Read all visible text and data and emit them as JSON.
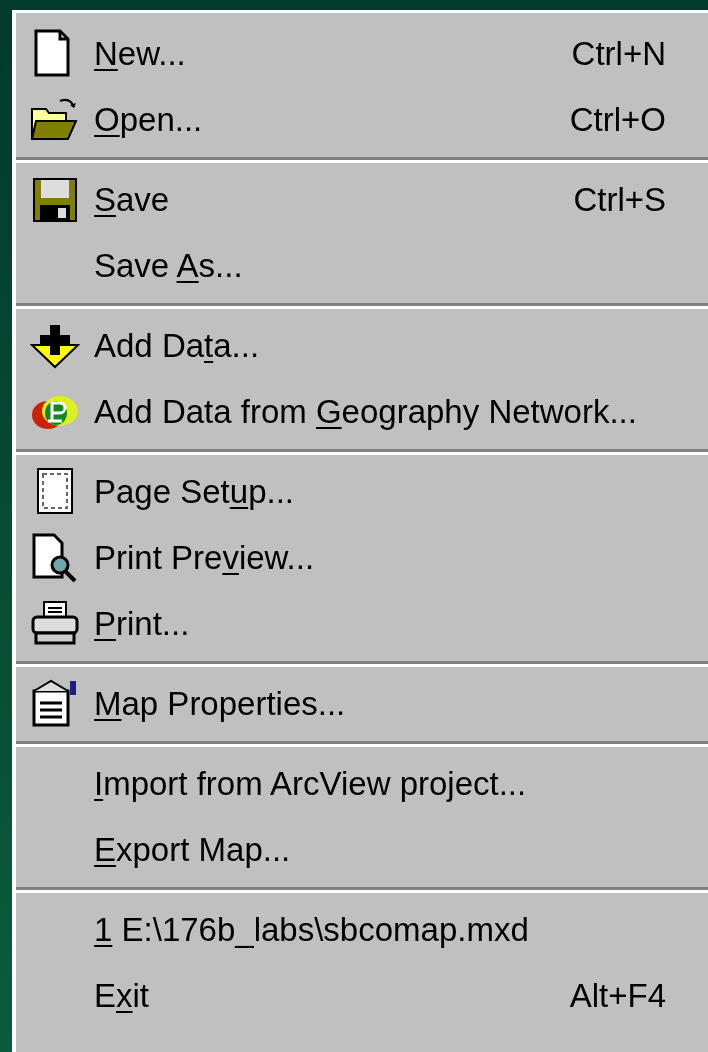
{
  "menu": {
    "items": [
      {
        "kind": "command",
        "key": "N",
        "after": "ew...",
        "shortcut": "Ctrl+N"
      },
      {
        "kind": "command",
        "key": "O",
        "after": "pen...",
        "shortcut": "Ctrl+O"
      },
      {
        "kind": "separator"
      },
      {
        "kind": "command",
        "key": "S",
        "after": "ave",
        "shortcut": "Ctrl+S"
      },
      {
        "kind": "command",
        "before": "Save ",
        "key": "A",
        "after": "s..."
      },
      {
        "kind": "separator"
      },
      {
        "kind": "command",
        "before": "Add Da",
        "key": "t",
        "after": "a..."
      },
      {
        "kind": "command",
        "before": "Add Data from ",
        "key": "G",
        "after": "eography Network..."
      },
      {
        "kind": "separator"
      },
      {
        "kind": "command",
        "before": "Page Set",
        "key": "u",
        "after": "p..."
      },
      {
        "kind": "command",
        "before": "Print Pre",
        "key": "v",
        "after": "iew..."
      },
      {
        "kind": "command",
        "key": "P",
        "after": "rint..."
      },
      {
        "kind": "separator"
      },
      {
        "kind": "command",
        "key": "M",
        "after": "ap Properties..."
      },
      {
        "kind": "separator"
      },
      {
        "kind": "command",
        "key": "I",
        "after": "mport from ArcView project..."
      },
      {
        "kind": "command",
        "key": "E",
        "after": "xport Map..."
      },
      {
        "kind": "separator"
      },
      {
        "kind": "command",
        "key": "1",
        "after": " E:\\176b_labs\\sbcomap.mxd"
      },
      {
        "kind": "command",
        "before": "E",
        "key": "x",
        "after": "it",
        "shortcut": "Alt+F4"
      }
    ]
  }
}
